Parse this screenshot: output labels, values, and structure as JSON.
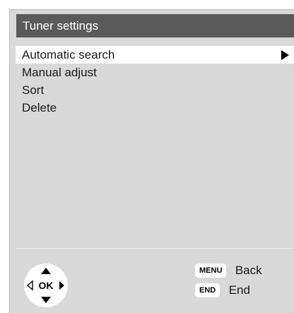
{
  "header": {
    "title": "Tuner settings"
  },
  "menu": {
    "items": [
      {
        "label": "Automatic search",
        "selected": true
      },
      {
        "label": "Manual adjust"
      },
      {
        "label": "Sort"
      },
      {
        "label": "Delete"
      }
    ]
  },
  "footer": {
    "ok_label": "OK",
    "keys": [
      {
        "key": "MENU",
        "action": "Back"
      },
      {
        "key": "END",
        "action": "End"
      }
    ]
  },
  "colors": {
    "panel_background": "#d9d9d9",
    "title_bar": "#5a5a5a",
    "selected_row": "#ffffff"
  }
}
